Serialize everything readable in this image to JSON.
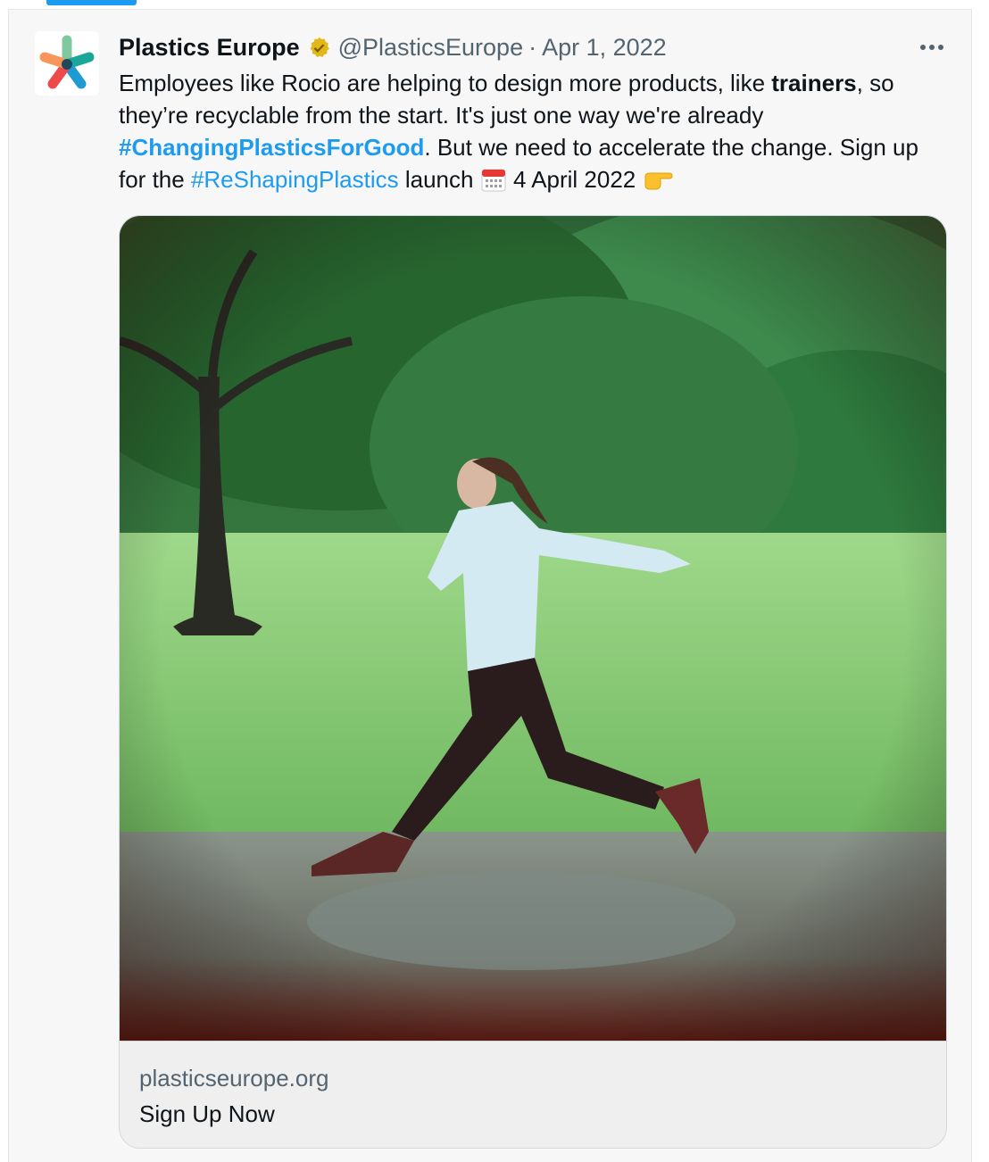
{
  "tweet": {
    "display_name": "Plastics Europe",
    "handle": "@PlasticsEurope",
    "separator": "·",
    "date": "Apr 1, 2022",
    "text": {
      "p1": "Employees like Rocio are helping to design more products, like ",
      "bold1": "trainers",
      "p2": ", so they’re recyclable from the start. It's just one way we're already ",
      "hashtag1": "#ChangingPlasticsForGood",
      "p3": ". But we need to accelerate the change. Sign up for the ",
      "hashtag2": "#ReShapingPlastics",
      "p4": " launch ",
      "p5": " 4 April 2022 "
    },
    "icons": {
      "verified": "verified-gold-badge-icon",
      "more": "more-options-icon",
      "calendar": "calendar-emoji-icon",
      "pointing": "pointing-right-emoji-icon",
      "avatar": "plastics-europe-logo"
    },
    "colors": {
      "accent": "#1d9bf0",
      "verified": "#e2b719",
      "text": "#0f1419",
      "secondary": "#536471"
    }
  },
  "card": {
    "image_alt": "photo-woman-running-in-park",
    "domain": "plasticseurope.org",
    "title": "Sign Up Now"
  }
}
